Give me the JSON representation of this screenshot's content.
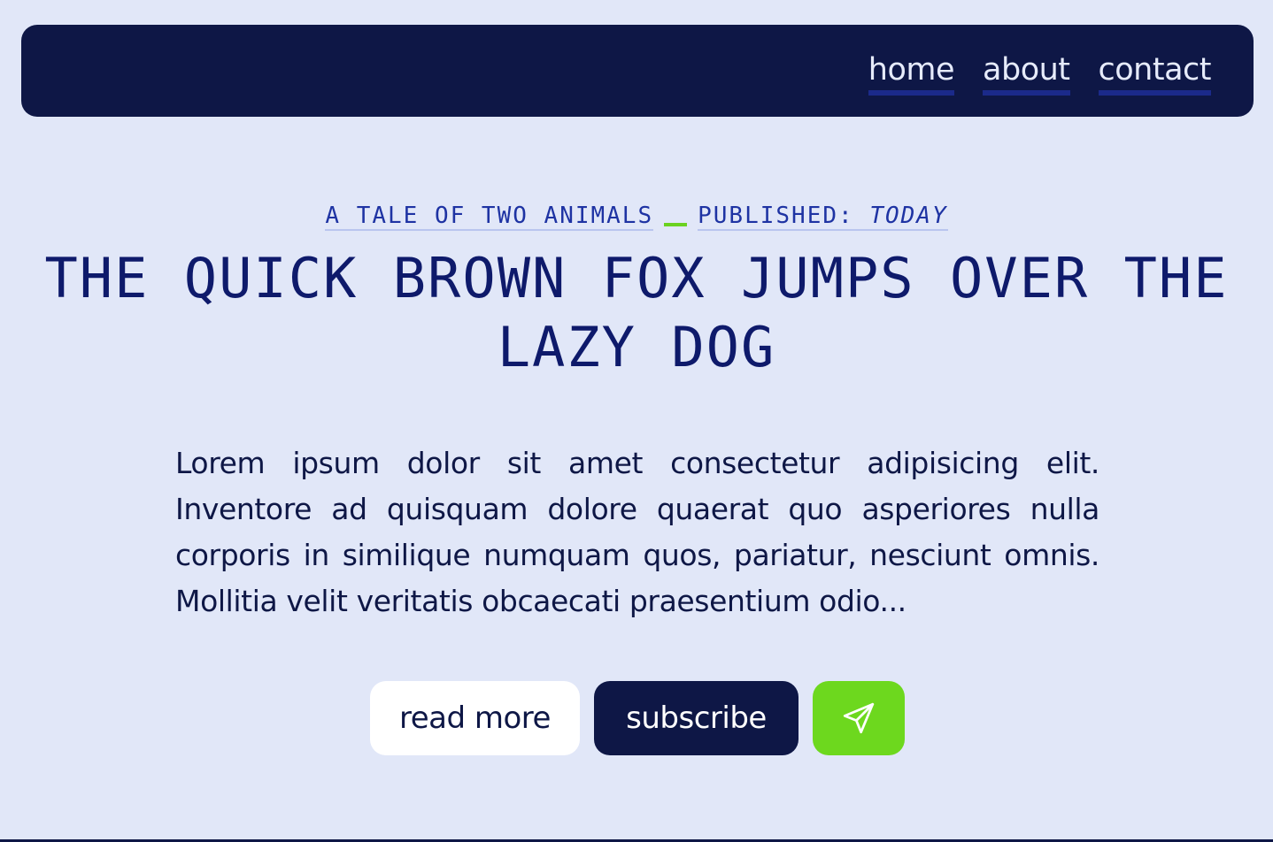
{
  "nav": {
    "links": [
      {
        "label": "home"
      },
      {
        "label": "about"
      },
      {
        "label": "contact"
      }
    ]
  },
  "article": {
    "kicker": "A TALE OF TWO ANIMALS",
    "published_label": "PUBLISHED:",
    "published_value": "TODAY",
    "title": "THE QUICK BROWN FOX JUMPS OVER THE LAZY DOG",
    "body": "Lorem ipsum dolor sit amet consectetur adipisicing elit. Inventore ad quisquam dolore quaerat quo asperiores nulla corporis in similique numquam quos, pariatur, nesciunt omnis. Mollitia velit veritatis obcaecati praesentium odio..."
  },
  "actions": {
    "read_more_label": "read more",
    "subscribe_label": "subscribe",
    "send_icon": "send-paper-plane-icon"
  },
  "colors": {
    "background": "#e1e7f8",
    "navy": "#0e1746",
    "accent_green": "#6dd81e",
    "link_blue": "#1e33a3"
  }
}
